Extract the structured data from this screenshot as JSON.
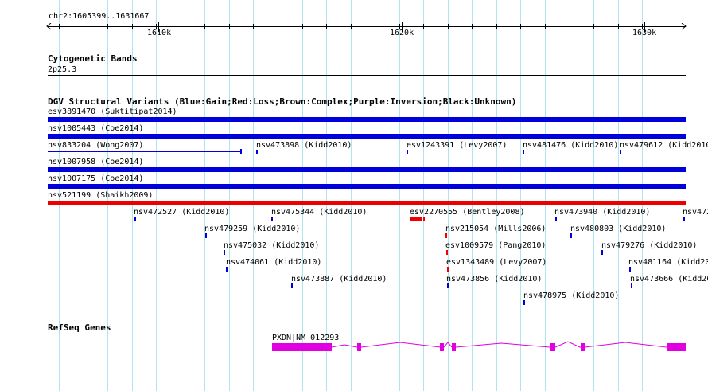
{
  "colors": {
    "gridline": "#b0e4ee",
    "gain": "#0000dd",
    "loss": "#ee0000",
    "gene": "#e000e0"
  },
  "ruler": {
    "coordinates": "chr2:1605399..1631667",
    "ticks": [
      "1610k",
      "1620k",
      "1630k"
    ]
  },
  "tracks": {
    "cytoband": {
      "title": "Cytogenetic Bands",
      "band": "2p25.3"
    },
    "dgv": {
      "title": "DGV Structural Variants (Blue:Gain;Red:Loss;Brown:Complex;Purple:Inversion;Black:Unknown)",
      "features": [
        {
          "label": "esv3891470 (Suktitipat2014)",
          "type": "gain"
        },
        {
          "label": "nsv1005443 (Coe2014)",
          "type": "gain"
        },
        {
          "label": "nsv833204 (Wong2007)",
          "type": "gain"
        },
        {
          "label": "nsv473898 (Kidd2010)",
          "type": "gain"
        },
        {
          "label": "esv1243391 (Levy2007)",
          "type": "gain"
        },
        {
          "label": "nsv481476 (Kidd2010)",
          "type": "gain"
        },
        {
          "label": "nsv479612 (Kidd2010)",
          "type": "gain"
        },
        {
          "label": "nsv1007958 (Coe2014)",
          "type": "gain"
        },
        {
          "label": "nsv1007175 (Coe2014)",
          "type": "gain"
        },
        {
          "label": "nsv521199 (Shaikh2009)",
          "type": "loss"
        },
        {
          "label": "nsv472527 (Kidd2010)",
          "type": "gain"
        },
        {
          "label": "nsv475344 (Kidd2010)",
          "type": "gain"
        },
        {
          "label": "esv2270555 (Bentley2008)",
          "type": "loss"
        },
        {
          "label": "nsv473940 (Kidd2010)",
          "type": "gain"
        },
        {
          "label": "nsv472",
          "type": "gain"
        },
        {
          "label": "nsv479259 (Kidd2010)",
          "type": "gain"
        },
        {
          "label": "nsv215054 (Mills2006)",
          "type": "loss"
        },
        {
          "label": "nsv480803 (Kidd2010)",
          "type": "gain"
        },
        {
          "label": "nsv475032 (Kidd2010)",
          "type": "gain"
        },
        {
          "label": "esv1009579 (Pang2010)",
          "type": "loss"
        },
        {
          "label": "nsv479276 (Kidd2010)",
          "type": "gain"
        },
        {
          "label": "nsv474061 (Kidd2010)",
          "type": "gain"
        },
        {
          "label": "esv1343489 (Levy2007)",
          "type": "loss"
        },
        {
          "label": "nsv481164 (Kidd20",
          "type": "gain"
        },
        {
          "label": "nsv473887 (Kidd2010)",
          "type": "gain"
        },
        {
          "label": "nsv473856 (Kidd2010)",
          "type": "gain"
        },
        {
          "label": "nsv473666 (Kidd20",
          "type": "gain"
        },
        {
          "label": "nsv478975 (Kidd2010)",
          "type": "gain"
        }
      ]
    },
    "refseq": {
      "title": "RefSeq Genes",
      "gene_label": "PXDN|NM_012293"
    }
  }
}
